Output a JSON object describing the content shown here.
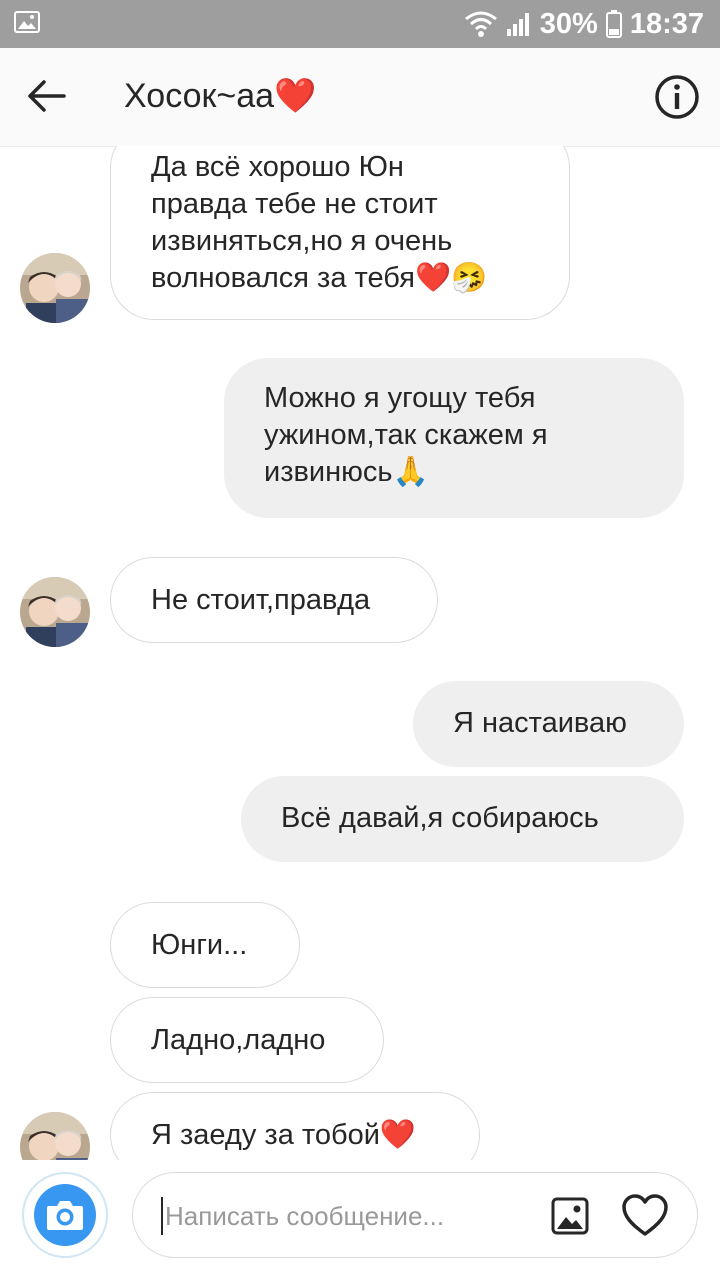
{
  "status_bar": {
    "battery_percent": "30%",
    "time": "18:37",
    "icons": [
      "image-notification-icon",
      "wifi-icon",
      "signal-icon",
      "battery-icon"
    ]
  },
  "header": {
    "title": "Хосок~аа",
    "title_emoji": "❤️",
    "icons": [
      "back-arrow-icon",
      "info-icon"
    ]
  },
  "messages": [
    {
      "direction": "in",
      "lines": [
        "Да всё хорошо Юн",
        "правда тебе не стоит",
        "извиняться,но я очень",
        "волновался за тебя"
      ],
      "emoji": "❤️🤧",
      "show_avatar": true
    },
    {
      "direction": "out",
      "lines": [
        "Можно я угощу тебя",
        "ужином,так скажем я",
        "извинюсь"
      ],
      "emoji": "🙏"
    },
    {
      "direction": "in",
      "lines": [
        "Не стоит,правда"
      ],
      "show_avatar": true
    },
    {
      "direction": "out",
      "lines": [
        "Я настаиваю"
      ]
    },
    {
      "direction": "out",
      "lines": [
        "Всё давай,я собираюсь"
      ]
    },
    {
      "direction": "in",
      "lines": [
        "Юнги..."
      ]
    },
    {
      "direction": "in",
      "lines": [
        "Ладно,ладно"
      ]
    },
    {
      "direction": "in",
      "lines": [
        "Я заеду за тобой"
      ],
      "emoji": "❤️",
      "show_avatar": true
    }
  ],
  "composer": {
    "placeholder": "Написать сообщение...",
    "icons": [
      "camera-icon",
      "gallery-icon",
      "heart-outline-icon"
    ]
  },
  "colors": {
    "status_bar_bg": "#9e9e9e",
    "header_bg": "#fafafa",
    "outgoing_bubble_bg": "#efefef",
    "incoming_bubble_border": "#dbdbdb",
    "camera_blue": "#3897f0",
    "heart_red": "#e0202b"
  }
}
